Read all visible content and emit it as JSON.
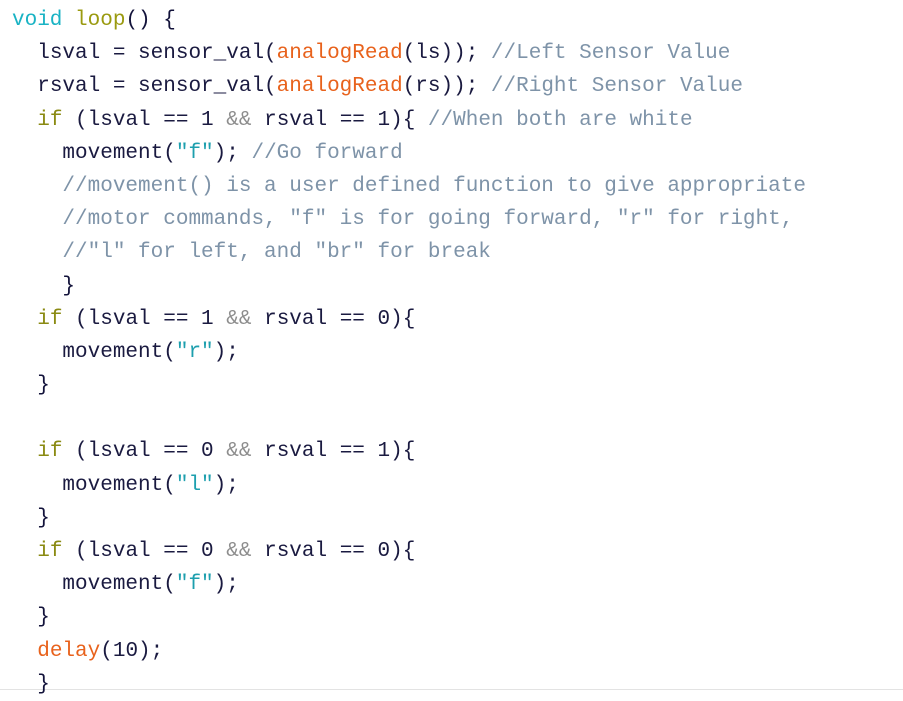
{
  "document": {
    "kind": "source-code-listing",
    "language": "Arduino C++",
    "colors": {
      "background": "#ffffff",
      "plain": "#1a1a40",
      "type": "#19b3c4",
      "user_function": "#9a9a10",
      "keyword": "#8a8a12",
      "builtin_function": "#e8621c",
      "string": "#1d9fae",
      "comment": "#7e93a8",
      "operator": "#8d8d8d",
      "bottom_border": "#e3e3e3"
    },
    "lines": [
      {
        "n": 1,
        "indent": 0,
        "tokens": [
          {
            "t": "void",
            "c": "tok-type"
          },
          {
            "t": " ",
            "c": "tok-plain"
          },
          {
            "t": "loop",
            "c": "tok-func-user"
          },
          {
            "t": "() {",
            "c": "tok-punct"
          }
        ]
      },
      {
        "n": 2,
        "indent": 1,
        "tokens": [
          {
            "t": "lsval = sensor_val(",
            "c": "tok-plain"
          },
          {
            "t": "analogRead",
            "c": "tok-builtin"
          },
          {
            "t": "(ls)); ",
            "c": "tok-plain"
          },
          {
            "t": "//Left Sensor Value",
            "c": "tok-comment"
          }
        ]
      },
      {
        "n": 3,
        "indent": 1,
        "tokens": [
          {
            "t": "rsval = sensor_val(",
            "c": "tok-plain"
          },
          {
            "t": "analogRead",
            "c": "tok-builtin"
          },
          {
            "t": "(rs)); ",
            "c": "tok-plain"
          },
          {
            "t": "//Right Sensor Value",
            "c": "tok-comment"
          }
        ]
      },
      {
        "n": 4,
        "indent": 1,
        "tokens": [
          {
            "t": "if",
            "c": "tok-keyword"
          },
          {
            "t": " (lsval == 1 ",
            "c": "tok-plain"
          },
          {
            "t": "&&",
            "c": "tok-op"
          },
          {
            "t": " rsval == 1){ ",
            "c": "tok-plain"
          },
          {
            "t": "//When both are white",
            "c": "tok-comment"
          }
        ]
      },
      {
        "n": 5,
        "indent": 2,
        "tokens": [
          {
            "t": "movement(",
            "c": "tok-plain"
          },
          {
            "t": "\"f\"",
            "c": "tok-string"
          },
          {
            "t": "); ",
            "c": "tok-plain"
          },
          {
            "t": "//Go forward",
            "c": "tok-comment"
          }
        ]
      },
      {
        "n": 6,
        "indent": 2,
        "tokens": [
          {
            "t": "//movement() is a user defined function to give appropriate",
            "c": "tok-comment"
          }
        ]
      },
      {
        "n": 7,
        "indent": 2,
        "tokens": [
          {
            "t": "//motor commands, \"f\" is for going forward, \"r\" for right,",
            "c": "tok-comment"
          }
        ]
      },
      {
        "n": 8,
        "indent": 2,
        "tokens": [
          {
            "t": "//\"l\" for left, and \"br\" for break",
            "c": "tok-comment"
          }
        ]
      },
      {
        "n": 9,
        "indent": 2,
        "tokens": [
          {
            "t": "}",
            "c": "tok-punct"
          }
        ]
      },
      {
        "n": 10,
        "indent": 1,
        "tokens": [
          {
            "t": "if",
            "c": "tok-keyword"
          },
          {
            "t": " (lsval == 1 ",
            "c": "tok-plain"
          },
          {
            "t": "&&",
            "c": "tok-op"
          },
          {
            "t": " rsval == 0){",
            "c": "tok-plain"
          }
        ]
      },
      {
        "n": 11,
        "indent": 2,
        "tokens": [
          {
            "t": "movement(",
            "c": "tok-plain"
          },
          {
            "t": "\"r\"",
            "c": "tok-string"
          },
          {
            "t": ");",
            "c": "tok-plain"
          }
        ]
      },
      {
        "n": 12,
        "indent": 1,
        "tokens": [
          {
            "t": "}",
            "c": "tok-punct"
          }
        ]
      },
      {
        "n": 13,
        "indent": 0,
        "blank": true,
        "tokens": []
      },
      {
        "n": 14,
        "indent": 1,
        "tokens": [
          {
            "t": "if",
            "c": "tok-keyword"
          },
          {
            "t": " (lsval == 0 ",
            "c": "tok-plain"
          },
          {
            "t": "&&",
            "c": "tok-op"
          },
          {
            "t": " rsval == 1){",
            "c": "tok-plain"
          }
        ]
      },
      {
        "n": 15,
        "indent": 2,
        "tokens": [
          {
            "t": "movement(",
            "c": "tok-plain"
          },
          {
            "t": "\"l\"",
            "c": "tok-string"
          },
          {
            "t": ");",
            "c": "tok-plain"
          }
        ]
      },
      {
        "n": 16,
        "indent": 1,
        "tokens": [
          {
            "t": "}",
            "c": "tok-punct"
          }
        ]
      },
      {
        "n": 17,
        "indent": 1,
        "tokens": [
          {
            "t": "if",
            "c": "tok-keyword"
          },
          {
            "t": " (lsval == 0 ",
            "c": "tok-plain"
          },
          {
            "t": "&&",
            "c": "tok-op"
          },
          {
            "t": " rsval == 0){",
            "c": "tok-plain"
          }
        ]
      },
      {
        "n": 18,
        "indent": 2,
        "tokens": [
          {
            "t": "movement(",
            "c": "tok-plain"
          },
          {
            "t": "\"f\"",
            "c": "tok-string"
          },
          {
            "t": ");",
            "c": "tok-plain"
          }
        ]
      },
      {
        "n": 19,
        "indent": 1,
        "tokens": [
          {
            "t": "}",
            "c": "tok-punct"
          }
        ]
      },
      {
        "n": 20,
        "indent": 1,
        "tokens": [
          {
            "t": "delay",
            "c": "tok-builtin"
          },
          {
            "t": "(10);",
            "c": "tok-plain"
          }
        ]
      },
      {
        "n": 21,
        "indent": 1,
        "tokens": [
          {
            "t": "}",
            "c": "tok-punct"
          }
        ]
      }
    ]
  }
}
